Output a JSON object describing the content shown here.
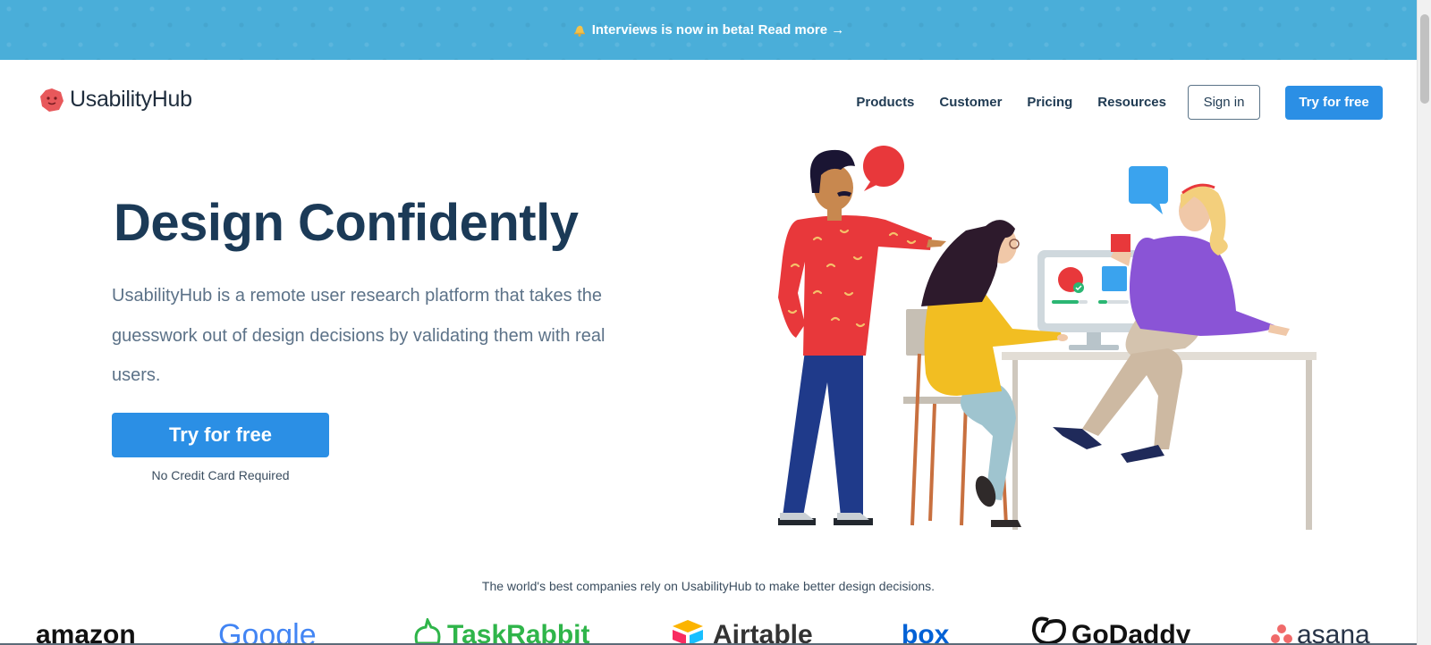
{
  "banner": {
    "icon": "bell-icon",
    "text": "Interviews is now in beta! Read more →",
    "color": "#4aaed9"
  },
  "header": {
    "logo_text": "UsabilityHub",
    "logo_icon": "usabilityhub-logo-icon",
    "nav": {
      "products": "Products",
      "customer": "Customer",
      "pricing": "Pricing",
      "resources": "Resources"
    },
    "sign_in": "Sign in",
    "try_free": "Try for free"
  },
  "hero": {
    "title": "Design Confidently",
    "subtitle": "UsabilityHub is a remote user research platform that takes the guesswork out of design decisions by validating them with real users.",
    "cta": "Try for free",
    "cta_note": "No Credit Card Required",
    "accent_color": "#2b8fe5"
  },
  "companies": {
    "tagline": "The world's best companies rely on UsabilityHub to make better design decisions.",
    "amazon": "amazon",
    "google": "Google",
    "taskrabbit": "TaskRabbit",
    "airtable": "Airtable",
    "box": "box",
    "godaddy": "GoDaddy",
    "asana": "asana"
  }
}
